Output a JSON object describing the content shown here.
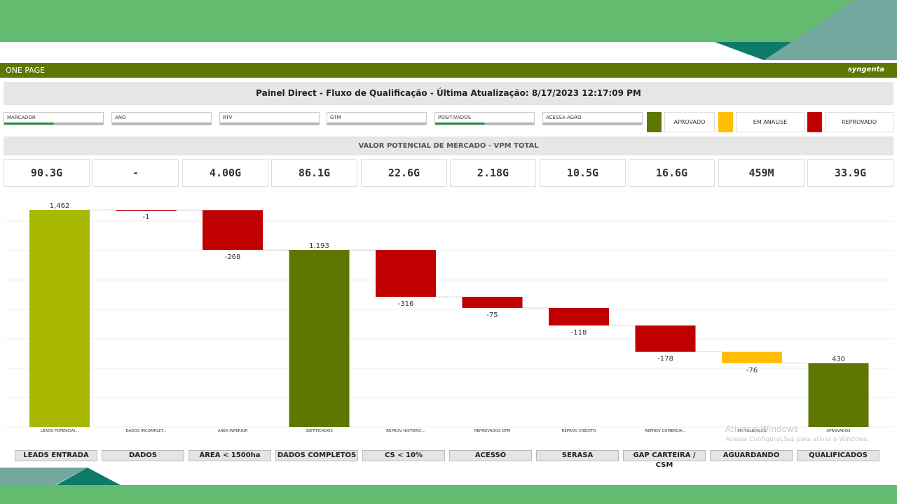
{
  "app": {
    "title": "ONE PAGE",
    "brand": "syngenta"
  },
  "header": {
    "title": "Painel Direct - Fluxo de Qualificação - Última Atualização: 8/17/2023 12:17:09 PM"
  },
  "filters": [
    {
      "label": "MARCADOR",
      "selected": true
    },
    {
      "label": "ANO",
      "selected": false
    },
    {
      "label": "RTV",
      "selected": false
    },
    {
      "label": "GTM",
      "selected": false
    },
    {
      "label": "POSITIVADOS",
      "selected": true
    },
    {
      "label": "ACESSA AGRO",
      "selected": false
    }
  ],
  "legend": [
    {
      "label": "APROVADO",
      "color": "#5d7700"
    },
    {
      "label": "EM ANALISE",
      "color": "#ffbf00"
    },
    {
      "label": "REPROVADO",
      "color": "#c00000"
    }
  ],
  "section": {
    "title": "VALOR POTENCIAL DE MERCADO - VPM TOTAL"
  },
  "kpis": [
    "90.3G",
    "-",
    "4.00G",
    "86.1G",
    "22.6G",
    "2.18G",
    "10.5G",
    "16.6G",
    "459M",
    "33.9G"
  ],
  "stages": [
    "LEADS ENTRADA",
    "DADOS",
    "ÁREA < 1500ha",
    "DADOS COMPLETOS",
    "CS < 10%",
    "ACESSO",
    "SERASA",
    "GAP CARTEIRA / CSM",
    "AGUARDANDO",
    "QUALIFICADOS"
  ],
  "chart_data": {
    "type": "bar",
    "subtype": "waterfall",
    "categories": [
      "LEADS POTENCIAI...",
      "DADOS INCOMPLET...",
      "AREA INFERIOR",
      "IDETIFICADOS",
      "REPROV HISTORIC...",
      "REPROVADOS GTM",
      "REPROV CRÉDITO",
      "REPROV COMERCIA...",
      "EM VALIDAÇÃO",
      "APROVADOS"
    ],
    "values": [
      1462,
      -1,
      -268,
      1193,
      -316,
      -75,
      -118,
      -178,
      -76,
      430
    ],
    "labels": [
      "1,462",
      "-1",
      "-268",
      "1,193",
      "-316",
      "-75",
      "-118",
      "-178",
      "-76",
      "430"
    ],
    "kinds": [
      "total",
      "delta",
      "delta",
      "total",
      "delta",
      "delta",
      "delta",
      "delta",
      "delta",
      "total"
    ],
    "colors": [
      "#a9b800",
      "#c00000",
      "#c00000",
      "#5d7700",
      "#c00000",
      "#c00000",
      "#c00000",
      "#c00000",
      "#ffbf00",
      "#5d7700"
    ],
    "ylim": [
      0,
      1462
    ],
    "grid": true,
    "legend": "none"
  },
  "watermark": {
    "line1": "Ativar o Windows",
    "line2": "Acesse Configurações para ativar o Windows."
  }
}
